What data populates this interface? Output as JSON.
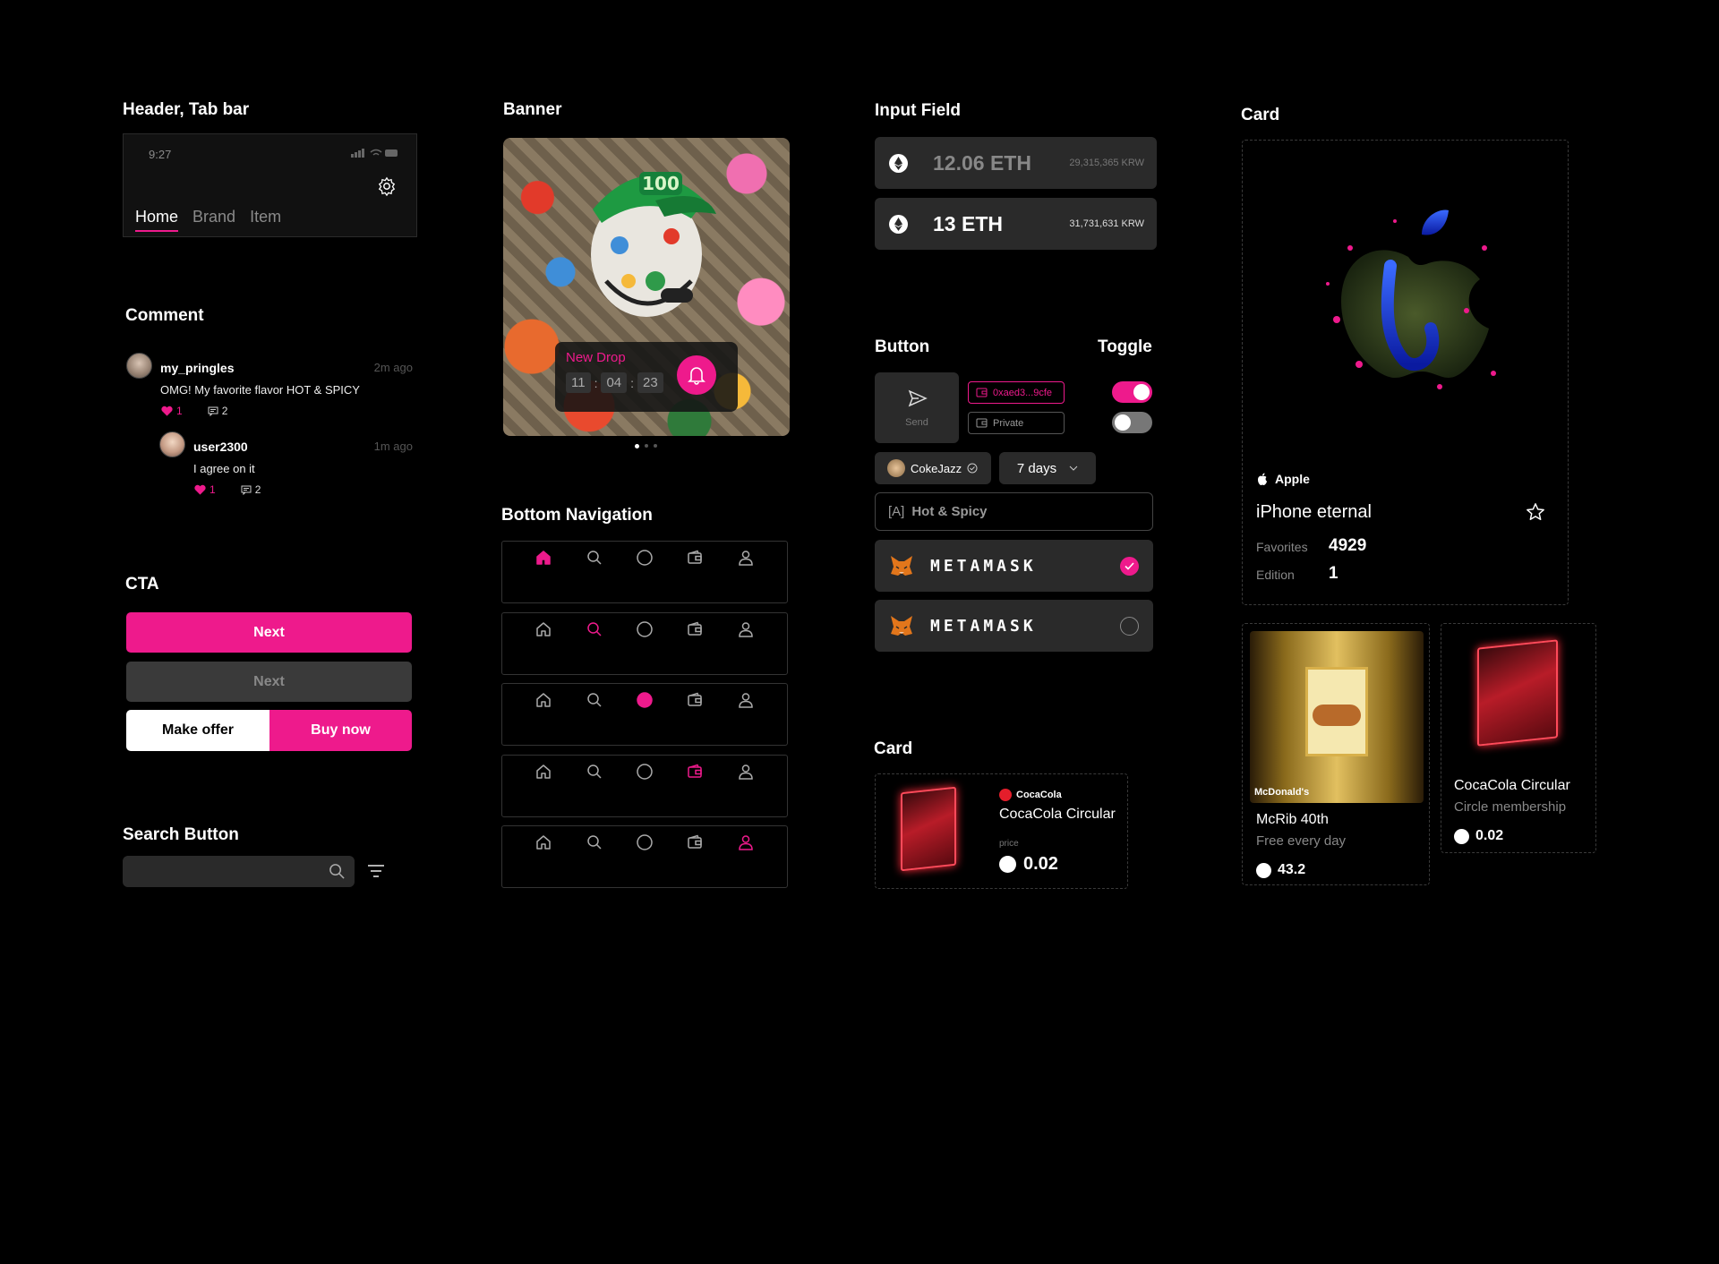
{
  "sections": {
    "header_tabbar": "Header, Tab bar",
    "comment": "Comment",
    "cta": "CTA",
    "search_button": "Search Button",
    "banner": "Banner",
    "bottom_navigation": "Bottom Navigation",
    "input_field": "Input Field",
    "button": "Button",
    "toggle": "Toggle",
    "card": "Card"
  },
  "header": {
    "time": "9:27",
    "tabs": [
      "Home",
      "Brand",
      "Item"
    ],
    "active_tab": "Home"
  },
  "comments": [
    {
      "user": "my_pringles",
      "time": "2m ago",
      "text": "OMG! My favorite flavor HOT & SPICY",
      "likes": "1",
      "replies": "2"
    },
    {
      "user": "user2300",
      "time": "1m ago",
      "text": "I agree on it",
      "likes": "1",
      "replies": "2"
    }
  ],
  "cta": {
    "next_active": "Next",
    "next_disabled": "Next",
    "make_offer": "Make offer",
    "buy_now": "Buy now"
  },
  "banner": {
    "label": "New Drop",
    "hours": "11",
    "minutes": "04",
    "seconds": "23",
    "page_count": 3,
    "active_page": 1
  },
  "bottom_navigation": {
    "icons": [
      "home-icon",
      "search-icon",
      "circle-icon",
      "wallet-icon",
      "profile-icon"
    ],
    "active_index_per_row": [
      0,
      1,
      2,
      3,
      4
    ]
  },
  "input_fields": [
    {
      "value": "12.06 ETH",
      "krw": "29,315,365 KRW",
      "muted": true
    },
    {
      "value": "13 ETH",
      "krw": "31,731,631 KRW",
      "muted": false
    }
  ],
  "buttons": {
    "send": "Send",
    "wallet_address": "0xaed3...9cfe",
    "private": "Private",
    "user_chip": "CokeJazz",
    "period_select": "7 days",
    "category_chip_prefix": "[A]",
    "category_chip": "Hot & Spicy",
    "wallet_options": [
      {
        "label": "METAMASK",
        "selected": true
      },
      {
        "label": "METAMASK",
        "selected": false
      }
    ]
  },
  "toggles": [
    {
      "on": true
    },
    {
      "on": false
    }
  ],
  "small_card": {
    "brand": "CocaCola",
    "title": "CocaCola Circular",
    "price_label": "price",
    "price": "0.02"
  },
  "main_card": {
    "brand": "Apple",
    "title": "iPhone eternal",
    "favorites_label": "Favorites",
    "favorites": "4929",
    "edition_label": "Edition",
    "edition": "1"
  },
  "grid_cards": [
    {
      "brand": "McDonald's",
      "title": "McRib 40th",
      "subtitle": "Free every day",
      "price": "43.2"
    },
    {
      "brand": "",
      "title": "CocaCola Circular",
      "subtitle": "Circle membership",
      "price": "0.02"
    }
  ],
  "colors": {
    "accent": "#ee1a8c",
    "background": "#000000",
    "surface": "#2a2a2a"
  }
}
